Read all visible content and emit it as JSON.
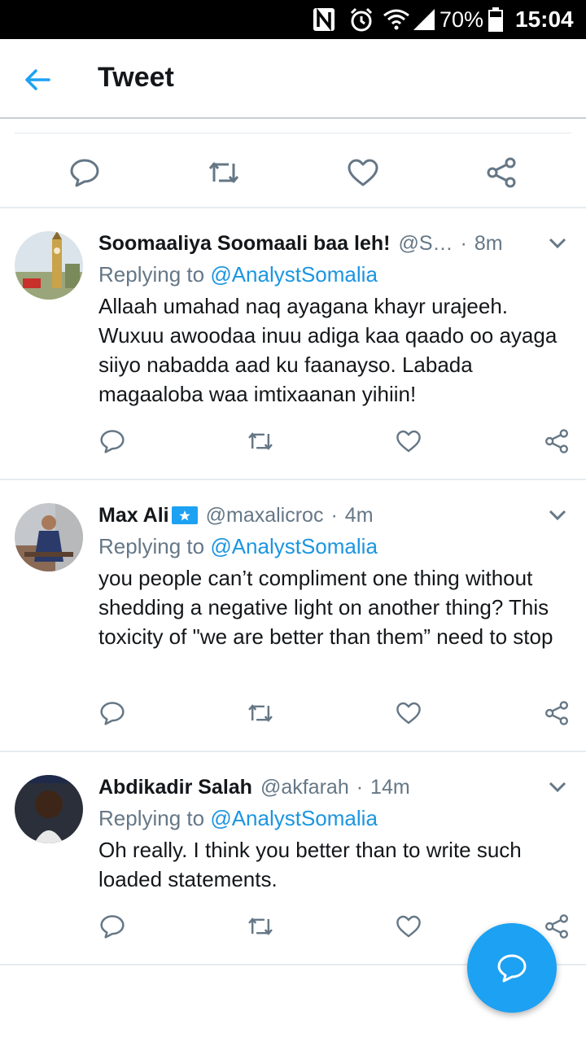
{
  "status_bar": {
    "battery_text": "70%",
    "time": "15:04",
    "icons": [
      "nfc-icon",
      "alarm-icon",
      "wifi-icon",
      "signal-icon",
      "battery-icon"
    ]
  },
  "header": {
    "title": "Tweet",
    "back_icon": "arrow-left-icon"
  },
  "replies": [
    {
      "name": "Soomaaliya Soomaali baa leh!",
      "handle": "@S…",
      "dot": "·",
      "time": "8m",
      "replying_prefix": "Replying to ",
      "replying_to": "@AnalystSomalia",
      "text": "Allaah umahad naq ayagana khayr urajeeh. Wuxuu awoodaa inuu adiga kaa qaado oo ayaga siiyo nabadda aad ku faanayso. Labada magaaloba waa imtixaanan yihiin!"
    },
    {
      "name": "Max Ali",
      "handle": "@maxalicroc",
      "dot": "·",
      "time": "4m",
      "replying_prefix": "Replying to ",
      "replying_to": "@AnalystSomalia",
      "text": "you people can’t compliment one thing without shedding a negative light on another thing? This toxicity of \"we are better than them” need to stop"
    },
    {
      "name": "Abdikadir Salah",
      "handle": "@akfarah",
      "dot": "·",
      "time": "14m",
      "replying_prefix": "Replying to ",
      "replying_to": "@AnalystSomalia",
      "text": "Oh really. I think you better than to write such loaded statements."
    }
  ],
  "colors": {
    "accent": "#1da1f2",
    "mention": "#1b95e0",
    "muted": "#657786",
    "icon": "#657786",
    "divider": "#e6ecf0"
  }
}
